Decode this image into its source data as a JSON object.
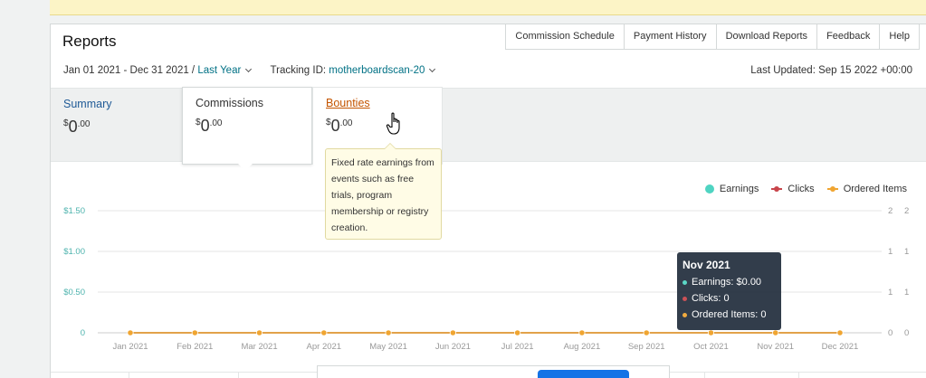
{
  "banner": {
    "text": "",
    "link": ""
  },
  "header": {
    "title": "Reports",
    "tabs": [
      "Commission Schedule",
      "Payment History",
      "Download Reports",
      "Feedback",
      "Help"
    ]
  },
  "filters": {
    "date_range": "Jan 01 2021 - Dec 31 2021 /",
    "period_link": "Last Year",
    "tracking_label": "Tracking ID:",
    "tracking_id": "motherboardscan-20",
    "last_updated": "Last Updated: Sep 15 2022 +00:00"
  },
  "summary_cards": [
    {
      "label": "Summary",
      "currency": "$",
      "whole": "0",
      "cents": ".00"
    },
    {
      "label": "Commissions",
      "currency": "$",
      "whole": "0",
      "cents": ".00"
    },
    {
      "label": "Bounties",
      "currency": "$",
      "whole": "0",
      "cents": ".00"
    }
  ],
  "bounties_tooltip": "Fixed rate earnings from events such as free trials, program membership or registry creation.",
  "legend": [
    {
      "label": "Earnings",
      "color": "#4fd4c2"
    },
    {
      "label": "Clicks",
      "color": "#c8454b"
    },
    {
      "label": "Ordered Items",
      "color": "#f0a531"
    }
  ],
  "chart_data": {
    "type": "line",
    "categories": [
      "Jan 2021",
      "Feb 2021",
      "Mar 2021",
      "Apr 2021",
      "May 2021",
      "Jun 2021",
      "Jul 2021",
      "Aug 2021",
      "Sep 2021",
      "Oct 2021",
      "Nov 2021",
      "Dec 2021"
    ],
    "series": [
      {
        "name": "Earnings",
        "axis": "left",
        "color": "#4fd4c2",
        "values": [
          0,
          0,
          0,
          0,
          0,
          0,
          0,
          0,
          0,
          0,
          0,
          0
        ]
      },
      {
        "name": "Clicks",
        "axis": "right1",
        "color": "#c8454b",
        "values": [
          0,
          0,
          0,
          0,
          0,
          0,
          0,
          0,
          0,
          0,
          0,
          0
        ]
      },
      {
        "name": "Ordered Items",
        "axis": "right2",
        "color": "#f0a531",
        "values": [
          0,
          0,
          0,
          0,
          0,
          0,
          0,
          0,
          0,
          0,
          0,
          0
        ]
      }
    ],
    "y_left_ticks": [
      "0",
      "$0.50",
      "$1.00",
      "$1.50"
    ],
    "y_left_lim": [
      0,
      1.5
    ],
    "y_right1_ticks": [
      "0",
      "1",
      "1",
      "2"
    ],
    "y_right2_ticks": [
      "0",
      "1",
      "1",
      "2"
    ],
    "grid": true,
    "legend_position": "top-right"
  },
  "hover_tooltip": {
    "title": "Nov 2021",
    "rows": [
      {
        "text": "Earnings: $0.00",
        "color": "#4fd4c2"
      },
      {
        "text": "Clicks: 0",
        "color": "#c8454b"
      },
      {
        "text": "Ordered Items: 0",
        "color": "#f0a531"
      }
    ]
  }
}
